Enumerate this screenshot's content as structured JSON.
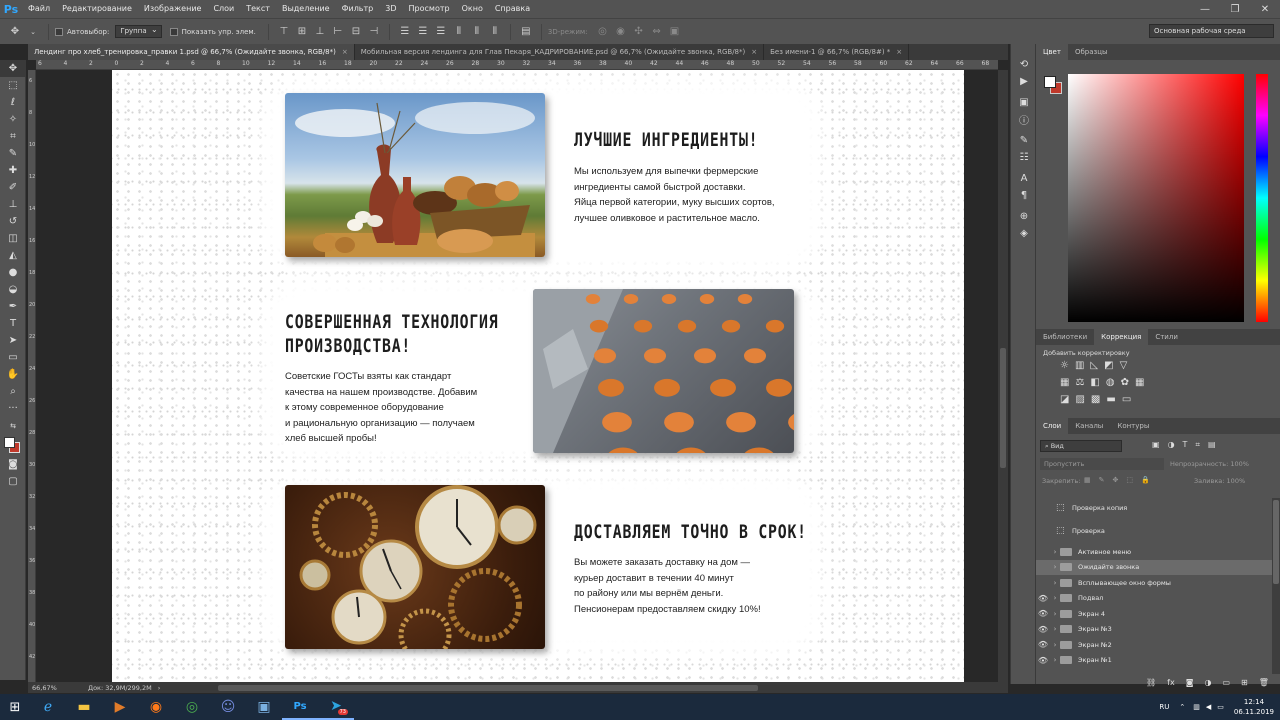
{
  "app": {
    "logo": "Ps",
    "menu": [
      "Файл",
      "Редактирование",
      "Изображение",
      "Слои",
      "Текст",
      "Выделение",
      "Фильтр",
      "3D",
      "Просмотр",
      "Окно",
      "Справка"
    ],
    "window_controls": [
      "—",
      "❐",
      "✕"
    ]
  },
  "options": {
    "autoselect_label": "Автовыбор:",
    "autoselect_value": "Группа",
    "show_controls_label": "Показать упр. элем.",
    "mode_3d_label": "3D-режим:",
    "workspace": "Основная рабочая среда"
  },
  "tabs": [
    {
      "label": "Лендинг про хлеб_тренировка_правки 1.psd @ 66,7% (Ожидайте звонка, RGB/8*)",
      "active": true
    },
    {
      "label": "Мобильная версия лендинга для Глав Пекаря_КАДРИРОВАНИЕ.psd @ 66,7% (Ожидайте звонка, RGB/8*)",
      "active": false
    },
    {
      "label": "Без имени-1 @ 66,7% (RGB/8#) *",
      "active": false
    }
  ],
  "ruler": {
    "h_ticks": [
      "6",
      "4",
      "2",
      "0",
      "2",
      "4",
      "6",
      "8",
      "10",
      "12",
      "14",
      "16",
      "18",
      "20",
      "22",
      "24",
      "26",
      "28",
      "30",
      "32",
      "34",
      "36",
      "38",
      "40",
      "42",
      "44",
      "46",
      "48",
      "50",
      "52",
      "54",
      "56",
      "58",
      "60",
      "62",
      "64",
      "66",
      "68"
    ],
    "v_ticks": [
      "6",
      "8",
      "10",
      "12",
      "14",
      "16",
      "18",
      "20",
      "22",
      "24",
      "26",
      "28",
      "30",
      "32",
      "34",
      "36",
      "38",
      "40",
      "42"
    ]
  },
  "document": {
    "sections": [
      {
        "title": "ЛУЧШИЕ ИНГРЕДИЕНТЫ!",
        "lines": [
          "Мы используем для выпечки фермерские",
          "ингредиенты самой быстрой доставки.",
          "Яйца первой категории, муку высших сортов,",
          "лучшее оливковое и растительное масло."
        ]
      },
      {
        "title_lines": [
          "СОВЕРШЕННАЯ ТЕХНОЛОГИЯ",
          "ПРОИЗВОДСТВА!"
        ],
        "lines": [
          "Советские ГОСТы взяты как стандарт",
          "качества на нашем производстве. Добавим",
          "к этому современное оборудование",
          "и рациональную организацию — получаем",
          "хлеб высшей пробы!"
        ]
      },
      {
        "title": "ДОСТАВЛЯЕМ ТОЧНО В СРОК!",
        "lines": [
          "Вы можете заказать доставку на дом —",
          "курьер доставит в течении 40 минут",
          "по району или мы вернём деньги.",
          "Пенсионерам предоставляем скидку 10%!"
        ]
      }
    ]
  },
  "status": {
    "zoom": "66,67%",
    "doc_size": "Док: 32,9M/299,2M"
  },
  "panels": {
    "color_tabs": [
      "Цвет",
      "Образцы"
    ],
    "adj_tabs": [
      "Библиотеки",
      "Коррекция",
      "Стили"
    ],
    "adj_title": "Добавить корректировку",
    "layer_tabs": [
      "Слои",
      "Каналы",
      "Контуры"
    ],
    "layer_filter": "Вид",
    "blend_mode": "Пропустить",
    "opacity_label": "Непрозрачность:",
    "opacity_value": "100%",
    "lock_label": "Закрепить:",
    "fill_label": "Заливка:",
    "fill_value": "100%",
    "layers": [
      {
        "name": "Проверка копия",
        "type": "artboard",
        "visible": false,
        "selected": false
      },
      {
        "name": "Проверка",
        "type": "artboard",
        "visible": false,
        "selected": false
      },
      {
        "name": "Активное меню",
        "type": "folder",
        "visible": false,
        "selected": false
      },
      {
        "name": "Ожидайте звонка",
        "type": "folder",
        "visible": false,
        "selected": true
      },
      {
        "name": "Всплывающее окно формы",
        "type": "folder",
        "visible": false,
        "selected": false
      },
      {
        "name": "Подвал",
        "type": "folder",
        "visible": true,
        "selected": false
      },
      {
        "name": "Экран 4",
        "type": "folder",
        "visible": true,
        "selected": false
      },
      {
        "name": "Экран №3",
        "type": "folder",
        "visible": true,
        "selected": false
      },
      {
        "name": "Экран №2",
        "type": "folder",
        "visible": true,
        "selected": false
      },
      {
        "name": "Экран №1",
        "type": "folder",
        "visible": true,
        "selected": false
      }
    ]
  },
  "taskbar": {
    "lang": "RU",
    "time": "12:14",
    "date": "06.11.2019",
    "telegram_badge": "73"
  }
}
